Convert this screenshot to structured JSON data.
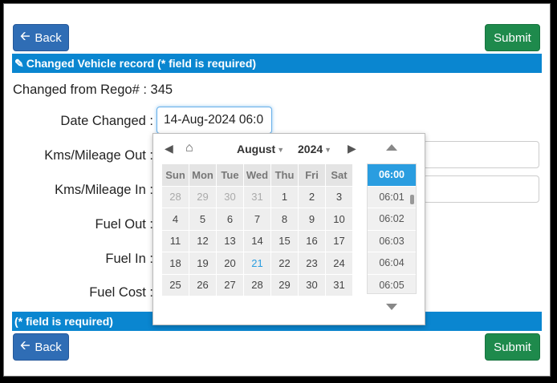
{
  "top_actions": {
    "back_label": "Back",
    "submit_label": "Submit"
  },
  "bottom_actions": {
    "back_label": "Back",
    "submit_label": "Submit"
  },
  "header_bar": {
    "title": "Changed Vehicle record (* field is required)"
  },
  "footer_bar": {
    "text": "(* field is required)"
  },
  "changed_from": {
    "label": "Changed from Rego# :",
    "value": "345"
  },
  "form": {
    "date_changed": {
      "label": "Date Changed :",
      "value": "14-Aug-2024 06:0"
    },
    "kms_out": {
      "label": "Kms/Mileage Out :"
    },
    "kms_in": {
      "label": "Kms/Mileage In :"
    },
    "fuel_out": {
      "label": "Fuel Out :"
    },
    "fuel_in": {
      "label": "Fuel In :"
    },
    "fuel_cost": {
      "label": "Fuel Cost :"
    }
  },
  "datepicker": {
    "month": "August",
    "year": "2024",
    "weekdays": [
      "Sun",
      "Mon",
      "Tue",
      "Wed",
      "Thu",
      "Fri",
      "Sat"
    ],
    "weeks": [
      [
        "28",
        "29",
        "30",
        "31",
        "1",
        "2",
        "3"
      ],
      [
        "4",
        "5",
        "6",
        "7",
        "8",
        "9",
        "10"
      ],
      [
        "11",
        "12",
        "13",
        "14",
        "15",
        "16",
        "17"
      ],
      [
        "18",
        "19",
        "20",
        "21",
        "22",
        "23",
        "24"
      ],
      [
        "25",
        "26",
        "27",
        "28",
        "29",
        "30",
        "31"
      ]
    ],
    "today": "21",
    "times": [
      "06:00",
      "06:01",
      "06:02",
      "06:03",
      "06:04",
      "06:05"
    ],
    "selected_time": "06:00"
  },
  "colors": {
    "primary_blue": "#2f6db5",
    "submit_green": "#1e8a4c",
    "bar_blue": "#0a86d0",
    "today_blue": "#2a9de0"
  },
  "icons": [
    "arrow-left-icon",
    "pencil-icon",
    "home-icon",
    "chevron-left-icon",
    "chevron-right-icon",
    "chevron-up-icon",
    "chevron-down-icon"
  ]
}
